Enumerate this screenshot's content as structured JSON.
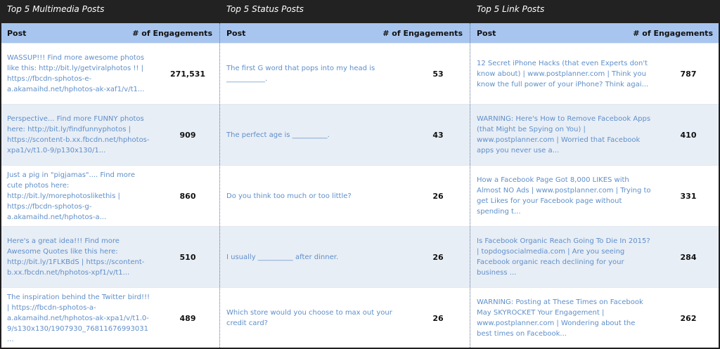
{
  "columns": [
    {
      "title": "Top 5 Multimedia Posts",
      "header_post": "Post",
      "header_engagements": "# of Engagements",
      "rows": [
        {
          "post": "WASSUP!!! Find more awesome photos like this: http://bit.ly/getviralphotos !! | https://fbcdn-sphotos-e-a.akamaihd.net/hphotos-ak-xaf1/v/t1...",
          "engagements": "271,531"
        },
        {
          "post": "Perspective... Find more FUNNY photos here: http://bit.ly/findfunnyphotos | https://scontent-b.xx.fbcdn.net/hphotos-xpa1/v/t1.0-9/p130x130/1...",
          "engagements": "909"
        },
        {
          "post": "Just a pig in \"pigjamas\".... Find more cute photos here: http://bit.ly/morephotoslikethis | https://fbcdn-sphotos-g-a.akamaihd.net/hphotos-a...",
          "engagements": "860"
        },
        {
          "post": "Here's a great idea!!! Find more Awesome Quotes like this here: http://bit.ly/1FLKBdS | https://scontent-b.xx.fbcdn.net/hphotos-xpf1/v/t1...",
          "engagements": "510"
        },
        {
          "post": "The inspiration behind the Twitter bird!!! | https://fbcdn-sphotos-a-a.akamaihd.net/hphotos-ak-xpa1/v/t1.0-9/s130x130/1907930_76811676993031...",
          "engagements": "489"
        }
      ]
    },
    {
      "title": "Top 5 Status Posts",
      "header_post": "Post",
      "header_engagements": "# of Engagements",
      "rows": [
        {
          "post": "The first G word that pops into my head is ___________.",
          "engagements": "53"
        },
        {
          "post": "The perfect age is __________.",
          "engagements": "43"
        },
        {
          "post": "Do you think too much or too little?",
          "engagements": "26"
        },
        {
          "post": "I usually __________ after dinner.",
          "engagements": "26"
        },
        {
          "post": "Which store would you choose to max out your credit card?",
          "engagements": "26"
        }
      ]
    },
    {
      "title": "Top 5 Link Posts",
      "header_post": "Post",
      "header_engagements": "# of Engagements",
      "rows": [
        {
          "post": "12 Secret iPhone Hacks (that even Experts don't know about) | www.postplanner.com | Think you know the full power of your iPhone? Think agai...",
          "engagements": "787"
        },
        {
          "post": "WARNING: Here's How to Remove Facebook Apps (that Might be Spying on You) | www.postplanner.com | Worried that Facebook apps you never use a...",
          "engagements": "410"
        },
        {
          "post": "How a Facebook Page Got 8,000 LIKES with Almost NO Ads | www.postplanner.com | Trying to get Likes for your Facebook page without spending t...",
          "engagements": "331"
        },
        {
          "post": "Is Facebook Organic Reach Going To Die In 2015? | topdogsocialmedia.com | Are you seeing Facebook organic reach declining for your business ...",
          "engagements": "284"
        },
        {
          "post": "WARNING: Posting at These Times on Facebook May SKYROCKET Your Engagement | www.postplanner.com | Wondering about the best times on Facebook...",
          "engagements": "262"
        }
      ]
    }
  ]
}
